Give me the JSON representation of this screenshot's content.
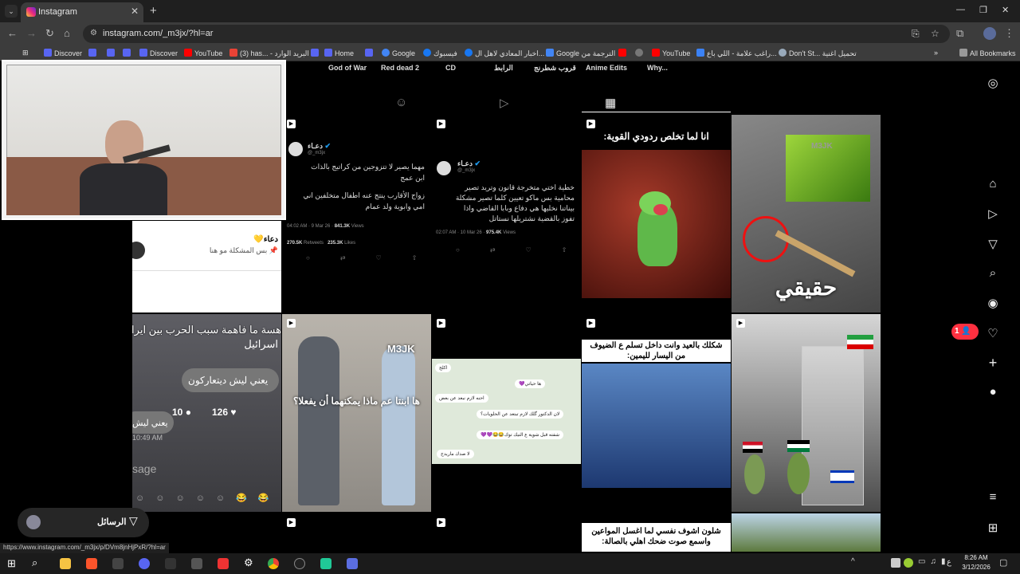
{
  "browser": {
    "tab_title": "Instagram",
    "url": "instagram.com/_m3jx/?hl=ar",
    "bookmarks": [
      "Discover",
      "Discover",
      "YouTube",
      "(3) has... - البريد الوارد",
      "Home",
      "Google",
      "فيسبوك",
      "اخبار المعادي لاهل ال...",
      "Google الترجمة من",
      "YouTube",
      "راغب علامة - اللي باع...",
      "Don't St... تحميل اغنية"
    ],
    "all_bookmarks": "All Bookmarks",
    "status_url": "https://www.instagram.com/_m3jx/p/DVm8jnHjPxR/?hl=ar"
  },
  "highlights": [
    "God of War",
    "Red dead 2",
    "CD",
    "الرابط",
    "قروب شطرنج",
    "Anime Edits",
    "Why..."
  ],
  "tweet1": {
    "name": "دعـاء",
    "handle": "@_m3jx",
    "line1": "مهما يصير لا تتزوجين من كراتيج بالذات",
    "line2": "ابن عمج",
    "line3": "زواج الأقارب ينتج عنه اطفال متخلفين اني",
    "line4": "امي وابوية ولد عمام",
    "time": "04:02 AM · 9 Mar 26",
    "views_count": "841.3K",
    "views_label": "Views",
    "retweets_count": "270.5K",
    "retweets_label": "Retweets",
    "likes_count": "235.3K",
    "likes_label": "Likes"
  },
  "tweet2": {
    "name": "دعـاء",
    "handle": "@_m3jx",
    "line1": "خطية اختي متخرجة قانون وتريد تصير",
    "line2": "محامية بس ماكو تعيين كلما تصير مشكلة",
    "line3": "بيناتنا نخليها هي دفاع وبابا القاضي واذا",
    "line4": "تفوز بالقضية نشتريلها نستاتل",
    "time": "02:07 AM · 10 Mar 26",
    "views_count": "975.4K",
    "views_label": "Views"
  },
  "frog_caption": "انا لما تخلص ردودي القوية:",
  "real_caption": "حقيقي",
  "post_card": {
    "name": "دعاء💛",
    "sub": "📌 بس المشكلة مو هنا"
  },
  "chat_post": {
    "text1": "هسة ما فاهمة سبب الحرب بين ايران",
    "text2": "اسرائيل",
    "bubble": "يعني ليش ديتعاركون",
    "bubble2": "يعني ليش",
    "likes": "126",
    "comments": "10",
    "time": "10:49 AM",
    "placeholder": "sage"
  },
  "m3jk_caption": "ها ابنتا عم ماذا يمكنهما أن يفعلا؟",
  "m3jk_tag": "M3JK",
  "whatsapp": [
    "اكلج",
    "ها حياتي💜",
    "احنه لازم نبعد عن بعض",
    "لان الدكتور گلك لازم تبتعد عن الحلويات؟",
    "شفته قبل شوية ع التيك توك😂😂💜💜",
    "لا صدك ماريدج"
  ],
  "eid_caption": "شكلك بالعيد وانت داخل تسلم ع الضيوف من اليسار لليمين:",
  "last_caption": "شلون اشوف نفسي لما اغسل المواعين واسمع صوت ضحك اهلي بالصالة:",
  "notif_count": "1",
  "messages_label": "الرسائل",
  "clock": {
    "time": "8:26 AM",
    "date": "3/12/2026"
  },
  "lang": "ع"
}
